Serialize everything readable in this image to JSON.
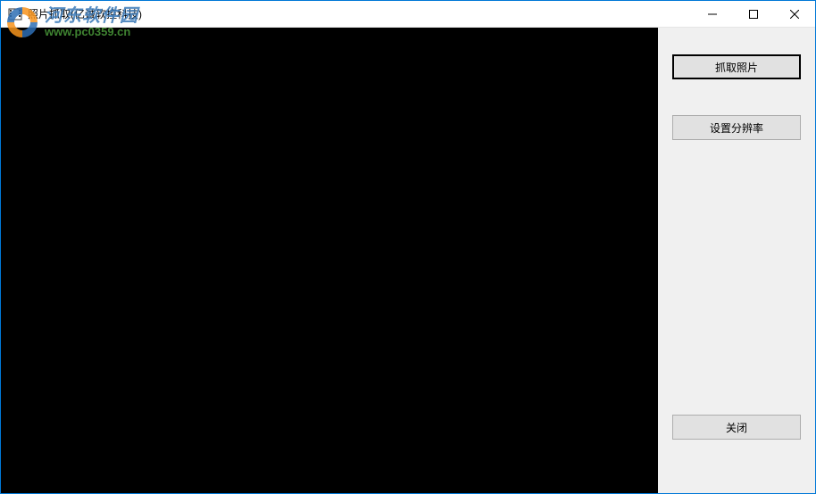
{
  "window": {
    "title": "照片抓取(亿诚软控科技)"
  },
  "sidebar": {
    "capture_label": "抓取照片",
    "resolution_label": "设置分辨率",
    "close_label": "关闭"
  },
  "watermark": {
    "title": "河东软件园",
    "url": "www.pc0359.cn"
  }
}
